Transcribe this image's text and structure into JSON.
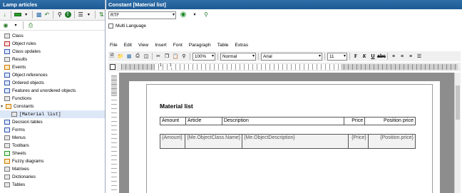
{
  "left_panel": {
    "title": "Lamp articles",
    "tree": [
      {
        "label": "Class",
        "icon": "class-icon",
        "color": "gray"
      },
      {
        "label": "Object rules",
        "icon": "object-rules-icon",
        "color": "red"
      },
      {
        "label": "Class updates",
        "icon": "class-updates-icon",
        "color": "blue"
      },
      {
        "label": "Results",
        "icon": "results-icon",
        "color": "gray"
      },
      {
        "label": "Events",
        "icon": "events-icon",
        "color": "orange"
      },
      {
        "label": "Object references",
        "icon": "object-references-icon",
        "color": "blue"
      },
      {
        "label": "Ordered objects",
        "icon": "ordered-objects-icon",
        "color": "blue"
      },
      {
        "label": "Features and unordered objects",
        "icon": "features-icon",
        "color": "blue"
      },
      {
        "label": "Functions",
        "icon": "functions-icon",
        "color": "gray"
      },
      {
        "label": "Constants",
        "icon": "constants-icon",
        "color": "orange",
        "expanded": true
      },
      {
        "label": "[Material list]",
        "icon": "constant-item-icon",
        "color": "gray",
        "child": true,
        "selected": true
      },
      {
        "label": "Decision tables",
        "icon": "decision-tables-icon",
        "color": "blue"
      },
      {
        "label": "Forms",
        "icon": "forms-icon",
        "color": "blue"
      },
      {
        "label": "Menus",
        "icon": "menus-icon",
        "color": "gray"
      },
      {
        "label": "Toolbars",
        "icon": "toolbars-icon",
        "color": "gray"
      },
      {
        "label": "Sheets",
        "icon": "sheets-icon",
        "color": "green"
      },
      {
        "label": "Fuzzy diagrams",
        "icon": "fuzzy-diagrams-icon",
        "color": "orange"
      },
      {
        "label": "Matrixes",
        "icon": "matrixes-icon",
        "color": "gray"
      },
      {
        "label": "Dictionaries",
        "icon": "dictionaries-icon",
        "color": "gray"
      },
      {
        "label": "Tables",
        "icon": "tables-icon",
        "color": "gray"
      }
    ]
  },
  "right_panel": {
    "title": "Constant [Material list]",
    "format_select": "RTF",
    "multi_language_label": "Multi Language",
    "menu": [
      "File",
      "Edit",
      "View",
      "Insert",
      "Font",
      "Paragraph",
      "Table",
      "Extras"
    ],
    "toolbar": {
      "zoom": "100%",
      "style": "Normal",
      "font": "Arial",
      "size": "11"
    },
    "ruler": {
      "marker_1": "1",
      "marker_2": "1"
    },
    "document": {
      "heading": "Material list",
      "headers": [
        "Amount",
        "Article",
        "Description",
        "Price",
        "Position price"
      ],
      "row": [
        "{Amount}",
        "{Me.ObjectClass.Name}",
        "{Me.ObjectDescription}",
        "{Price}",
        "{Position.price}"
      ]
    }
  },
  "colors": {
    "title_bar": "#1d5a94",
    "selected_item": "#dde8f7",
    "doc_background": "#8d8d8d"
  }
}
